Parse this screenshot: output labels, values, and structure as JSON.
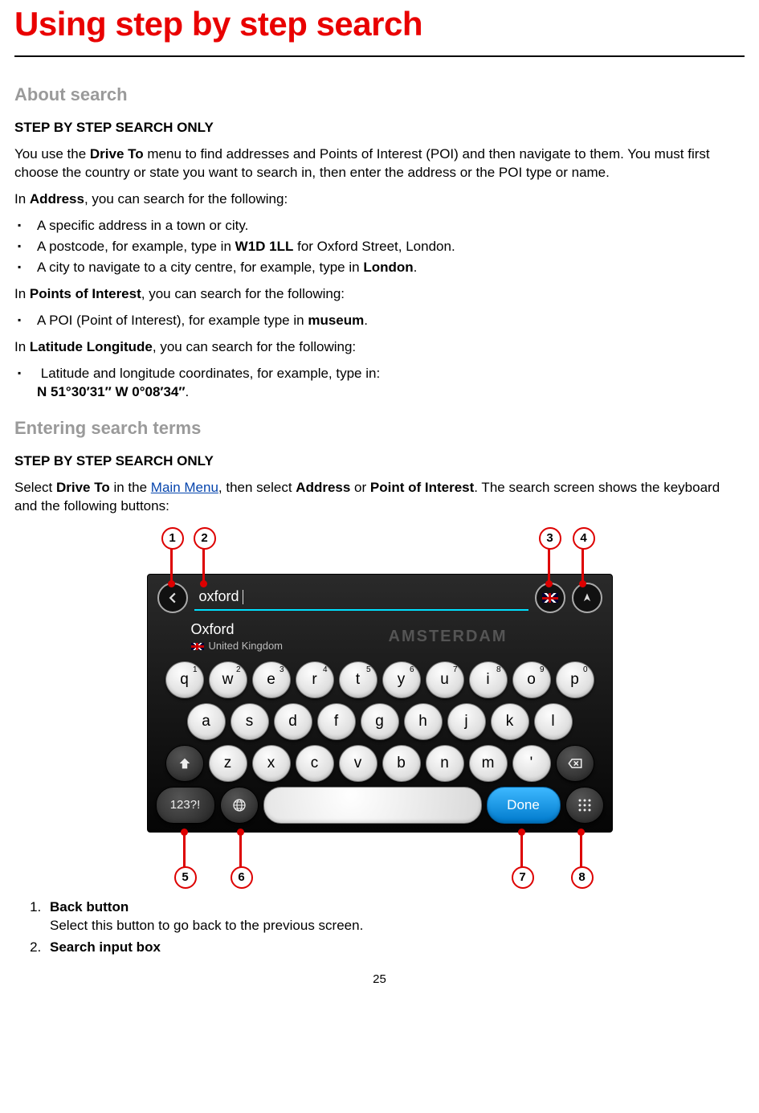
{
  "title": "Using step by step search",
  "pageNumber": "25",
  "sections": {
    "about": {
      "heading": "About search",
      "sub": "STEP BY STEP SEARCH ONLY",
      "intro_pre": "You use the ",
      "intro_bold1": "Drive To",
      "intro_post1": " menu to find addresses and Points of Interest (POI) and then navigate to them. You must first choose the country or state you want to search in, then enter the address or the POI type or name.",
      "addr_pre": "In ",
      "addr_bold": "Address",
      "addr_post": ", you can search for the following:",
      "addr_items": [
        {
          "text_a": "A specific address in a town or city."
        },
        {
          "text_a": "A postcode, for example, type in ",
          "bold": "W1D 1LL",
          "text_b": " for Oxford Street, London."
        },
        {
          "text_a": "A city to navigate to a city centre, for example, type in ",
          "bold": "London",
          "text_b": "."
        }
      ],
      "poi_pre": "In ",
      "poi_bold": "Points of Interest",
      "poi_post": ", you can search for the following:",
      "poi_items": [
        {
          "text_a": "A POI (Point of Interest), for example type in ",
          "bold": "museum",
          "text_b": "."
        }
      ],
      "ll_pre": "In ",
      "ll_bold": "Latitude Longitude",
      "ll_post": ", you can search for the following:",
      "ll_items": [
        {
          "text_a": "Latitude and longitude coordinates, for example, type in:",
          "line2_bold": "N 51°30′31″    W 0°08′34″",
          "line2_post": "."
        }
      ]
    },
    "entering": {
      "heading": "Entering search terms",
      "sub": "STEP BY STEP SEARCH ONLY",
      "p1_a": "Select ",
      "p1_b": "Drive To",
      "p1_c": " in the ",
      "link": "Main Menu",
      "p1_d": ", then select ",
      "p1_e": "Address",
      "p1_f": " or ",
      "p1_g": "Point of Interest",
      "p1_h": ". The search screen shows the keyboard and the following buttons:"
    }
  },
  "keyboard": {
    "searchText": "oxford",
    "suggestCity": "Oxford",
    "suggestCountry": "United Kingdom",
    "mapWatermark": "AMSTERDAM",
    "row1": [
      "q",
      "w",
      "e",
      "r",
      "t",
      "y",
      "u",
      "i",
      "o",
      "p"
    ],
    "row1sup": [
      "1",
      "2",
      "3",
      "4",
      "5",
      "6",
      "7",
      "8",
      "9",
      "0"
    ],
    "row2": [
      "a",
      "s",
      "d",
      "f",
      "g",
      "h",
      "j",
      "k",
      "l"
    ],
    "row3": [
      "z",
      "x",
      "c",
      "v",
      "b",
      "n",
      "m",
      "'"
    ],
    "modeKey": "123?!",
    "doneKey": "Done"
  },
  "callouts": [
    {
      "n": "1",
      "title": "Back button",
      "desc": "Select this button to go back to the previous screen."
    },
    {
      "n": "2",
      "title": "Search input box"
    }
  ]
}
